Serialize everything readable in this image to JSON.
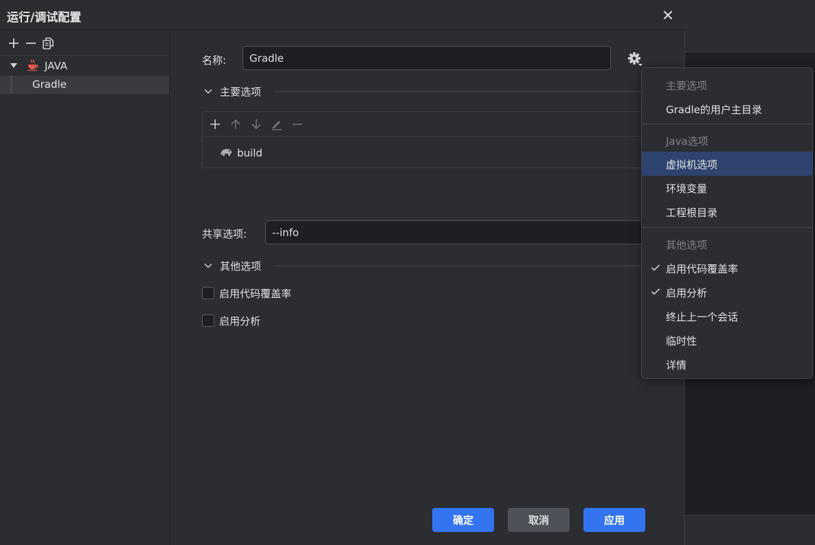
{
  "dialog": {
    "title": "运行/调试配置"
  },
  "tree": {
    "root_label": "JAVA",
    "child_label": "Gradle"
  },
  "form": {
    "name_label": "名称:",
    "name_value": "Gradle",
    "main_section": "主要选项",
    "task_name": "build",
    "shared_label": "共享选项:",
    "shared_value": "--info",
    "other_section": "其他选项",
    "checkbox_coverage": "启用代码覆盖率",
    "checkbox_profiling": "启用分析"
  },
  "buttons": {
    "ok": "确定",
    "cancel": "取消",
    "apply": "应用"
  },
  "menu": {
    "header_main": "主要选项",
    "gradle_home": "Gradle的用户主目录",
    "header_java": "Java选项",
    "vm_options": "虚拟机选项",
    "env_vars": "环境变量",
    "project_root": "工程根目录",
    "header_other": "其他选项",
    "coverage": "启用代码覆盖率",
    "profiling": "启用分析",
    "terminate_previous": "终止上一个会话",
    "temporary": "临时性",
    "details": "详情"
  },
  "colors": {
    "accent": "#3574f0",
    "selection": "#2e436e",
    "java_icon": "#e05a4f"
  }
}
